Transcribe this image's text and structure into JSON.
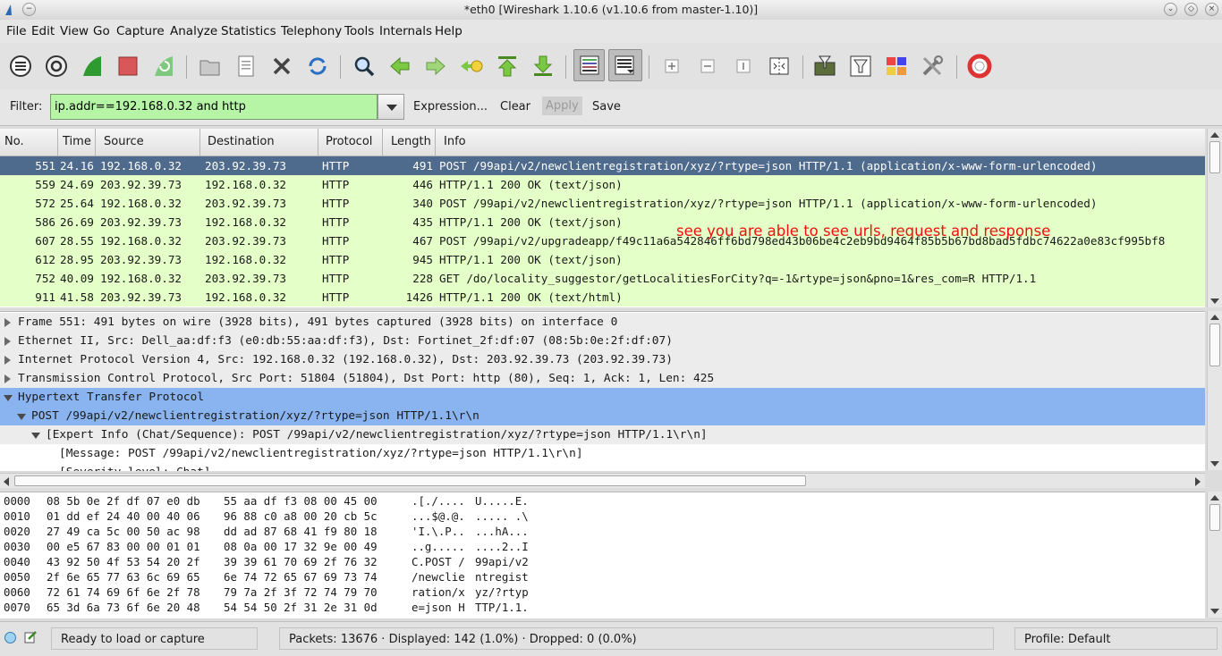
{
  "window": {
    "title": "*eth0  [Wireshark 1.10.6  (v1.10.6 from master-1.10)]"
  },
  "menu": [
    "File",
    "Edit",
    "View",
    "Go",
    "Capture",
    "Analyze",
    "Statistics",
    "Telephony",
    "Tools",
    "Internals",
    "Help"
  ],
  "toolbar_icons": [
    "interface-list-icon",
    "capture-options-icon",
    "start-capture-icon",
    "stop-capture-icon",
    "restart-capture-icon",
    "open-file-icon",
    "save-file-icon",
    "close-file-icon",
    "reload-icon",
    "find-packet-icon",
    "go-back-icon",
    "go-forward-icon",
    "go-to-packet-icon",
    "first-packet-icon",
    "last-packet-icon",
    "colorize-icon",
    "auto-scroll-icon",
    "zoom-in-icon",
    "zoom-out-icon",
    "normal-size-icon",
    "resize-columns-icon",
    "capture-filters-icon",
    "display-filters-icon",
    "coloring-rules-icon",
    "preferences-icon",
    "help-icon"
  ],
  "filter": {
    "label": "Filter:",
    "value": "ip.addr==192.168.0.32 and http",
    "expression": "Expression...",
    "clear": "Clear",
    "apply": "Apply",
    "save": "Save"
  },
  "packet_list": {
    "columns": [
      "No.",
      "Time",
      "Source",
      "Destination",
      "Protocol",
      "Length",
      "Info"
    ],
    "rows": [
      [
        "551",
        "24.16",
        "192.168.0.32",
        "203.92.39.73",
        "HTTP",
        "491",
        "POST /99api/v2/newclientregistration/xyz/?rtype=json HTTP/1.1  (application/x-www-form-urlencoded)"
      ],
      [
        "559",
        "24.69",
        "203.92.39.73",
        "192.168.0.32",
        "HTTP",
        "446",
        "HTTP/1.1 200 OK  (text/json)"
      ],
      [
        "572",
        "25.64",
        "192.168.0.32",
        "203.92.39.73",
        "HTTP",
        "340",
        "POST /99api/v2/newclientregistration/xyz/?rtype=json HTTP/1.1  (application/x-www-form-urlencoded)"
      ],
      [
        "586",
        "26.69",
        "203.92.39.73",
        "192.168.0.32",
        "HTTP",
        "435",
        "HTTP/1.1 200 OK  (text/json)"
      ],
      [
        "607",
        "28.55",
        "192.168.0.32",
        "203.92.39.73",
        "HTTP",
        "467",
        "POST /99api/v2/upgradeapp/f49c11a6a542846ff6bd798ed43b06be4c2eb9bd9464f85b5b67bd8bad5fdbc74622a0e83cf995bf8"
      ],
      [
        "612",
        "28.95",
        "203.92.39.73",
        "192.168.0.32",
        "HTTP",
        "945",
        "HTTP/1.1 200 OK  (text/json)"
      ],
      [
        "752",
        "40.09",
        "192.168.0.32",
        "203.92.39.73",
        "HTTP",
        "228",
        "GET /do/locality_suggestor/getLocalitiesForCity?q=-1&rtype=json&pno=1&res_com=R HTTP/1.1"
      ],
      [
        "911",
        "41.58",
        "203.92.39.73",
        "192.168.0.32",
        "HTTP",
        "1426",
        "HTTP/1.1 200 OK  (text/html)"
      ]
    ],
    "annotation": "see you are able to see urls, request and response"
  },
  "detail_tree": [
    "Frame 551: 491 bytes on wire (3928 bits), 491 bytes captured (3928 bits) on interface 0",
    "Ethernet II, Src: Dell_aa:df:f3 (e0:db:55:aa:df:f3), Dst: Fortinet_2f:df:07 (08:5b:0e:2f:df:07)",
    "Internet Protocol Version 4, Src: 192.168.0.32 (192.168.0.32), Dst: 203.92.39.73 (203.92.39.73)",
    "Transmission Control Protocol, Src Port: 51804 (51804), Dst Port: http (80), Seq: 1, Ack: 1, Len: 425",
    "Hypertext Transfer Protocol",
    "POST /99api/v2/newclientregistration/xyz/?rtype=json HTTP/1.1\\r\\n",
    "[Expert Info (Chat/Sequence): POST /99api/v2/newclientregistration/xyz/?rtype=json HTTP/1.1\\r\\n]",
    "[Message: POST /99api/v2/newclientregistration/xyz/?rtype=json HTTP/1.1\\r\\n]",
    "[Severity level: Chat]"
  ],
  "hex_dump": [
    [
      "0000",
      "08 5b 0e 2f df 07 e0 db",
      "55 aa df f3 08 00 45 00",
      ".[./....",
      "U.....E."
    ],
    [
      "0010",
      "01 dd ef 24 40 00 40 06",
      "96 88 c0 a8 00 20 cb 5c",
      "...$@.@.",
      "..... .\\"
    ],
    [
      "0020",
      "27 49 ca 5c 00 50 ac 98",
      "dd ad 87 68 41 f9 80 18",
      "'I.\\.P..",
      "...hA..."
    ],
    [
      "0030",
      "00 e5 67 83 00 00 01 01",
      "08 0a 00 17 32 9e 00 49",
      "..g.....",
      "....2..I"
    ],
    [
      "0040",
      "43 92 50 4f 53 54 20 2f",
      "39 39 61 70 69 2f 76 32",
      "C.POST /",
      "99api/v2"
    ],
    [
      "0050",
      "2f 6e 65 77 63 6c 69 65",
      "6e 74 72 65 67 69 73 74",
      "/newclie",
      "ntregist"
    ],
    [
      "0060",
      "72 61 74 69 6f 6e 2f 78",
      "79 7a 2f 3f 72 74 79 70",
      "ration/x",
      "yz/?rtyp"
    ],
    [
      "0070",
      "65 3d 6a 73 6f 6e 20 48",
      "54 54 50 2f 31 2e 31 0d",
      "e=json H",
      "TTP/1.1."
    ]
  ],
  "status": {
    "ready": "Ready to load or capture",
    "packets": "Packets: 13676 · Displayed: 142 (1.0%) · Dropped: 0 (0.0%)",
    "profile": "Profile: Default"
  }
}
